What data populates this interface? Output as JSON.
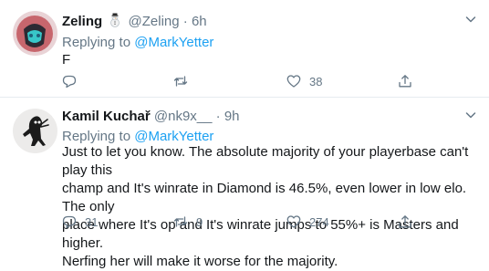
{
  "tweets": [
    {
      "name": "Zeling",
      "handle": "@Zeling",
      "time": "6h",
      "replying_prefix": "Replying to",
      "replying_to": "@MarkYetter",
      "text_lines": [
        "F"
      ],
      "counts": {
        "replies": "",
        "retweets": "",
        "likes": "38"
      },
      "icons": {
        "reply": "comment-icon",
        "retweet": "retweet-icon",
        "like": "heart-icon",
        "share": "share-icon",
        "menu": "chevron-down-icon"
      }
    },
    {
      "name": "Kamil Kuchař",
      "handle": "@nk9x__",
      "time": "9h",
      "replying_prefix": "Replying to",
      "replying_to": "@MarkYetter",
      "text_lines": [
        "Just to let you know. The absolute majority of your playerbase can't play this",
        "champ and It's winrate in Diamond is 46.5%, even lower in low elo. The only",
        "place where It's op and It's winrate jumps to 55%+ is Masters and higher.",
        "Nerfing her will make it worse for the majority."
      ],
      "counts": {
        "replies": "31",
        "retweets": "9",
        "likes": "274"
      },
      "icons": {
        "reply": "comment-icon",
        "retweet": "retweet-icon",
        "like": "heart-icon",
        "share": "share-icon",
        "menu": "chevron-down-icon"
      }
    }
  ],
  "separator": "·",
  "colors": {
    "text": "#14171a",
    "secondary": "#657786",
    "link": "#1da1f2",
    "divider": "#e6ecf0"
  }
}
